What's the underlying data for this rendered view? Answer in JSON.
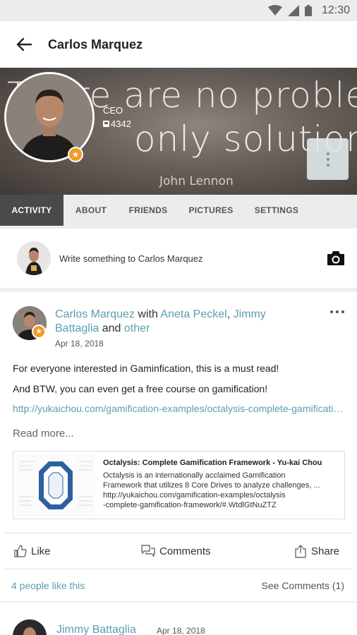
{
  "status_bar": {
    "time": "12:30",
    "icons": [
      "wifi-icon",
      "signal-icon",
      "battery-icon"
    ]
  },
  "app_bar": {
    "title": "Carlos Marquez",
    "back_icon": "arrow-left-icon"
  },
  "cover": {
    "quote_line1": "There are no problems,",
    "quote_line2": "only solutions.",
    "quote_author": "John Lennon",
    "role": "CEO",
    "points": "4342",
    "menu_icon": "vertical-dots-icon"
  },
  "tabs": [
    {
      "label": "ACTIVITY",
      "active": true
    },
    {
      "label": "ABOUT",
      "active": false
    },
    {
      "label": "FRIENDS",
      "active": false
    },
    {
      "label": "PICTURES",
      "active": false
    },
    {
      "label": "SETTINGS",
      "active": false
    }
  ],
  "composer": {
    "placeholder": "Write something to Carlos Marquez",
    "camera_icon": "camera-icon"
  },
  "post": {
    "author": "Carlos Marquez",
    "with_word": "with",
    "tagged1": "Aneta Peckel",
    "tagged2": "Jimmy Battaglia",
    "and_word": "and",
    "other": "other",
    "date": "Apr 18, 2018",
    "text_line1": "For everyone interested in Gaminfication, this is a must read!",
    "text_line2": "And BTW, you can even get a free course on gamification!",
    "url": "http://yukaichou.com/gamification-examples/octalysis-complete-gamification-framework/",
    "read_more": "Read more...",
    "link_card": {
      "title": "Octalysis: Complete Gamification Framework - Yu-kai Chou",
      "desc_line1": "Octalysis is an internationally acclaimed Gamification",
      "desc_line2": "Framework that utilizes 8 Core Drives to analyze challenges, ...",
      "desc_line3": "http://yukaichou.com/gamification-examples/octalysis",
      "desc_line4": "-complete-gamification-framework/#.WtdlGtNuZTZ"
    },
    "actions": {
      "like": "Like",
      "comments": "Comments",
      "share": "Share"
    },
    "likes_text": "4 people like this",
    "see_comments": "See Comments (1)"
  },
  "next_post": {
    "author": "Jimmy Battaglia",
    "date": "Apr 18, 2018"
  },
  "colors": {
    "link": "#5b9eb1",
    "active_tab": "#4a4a4a",
    "badge": "#f39a21"
  }
}
